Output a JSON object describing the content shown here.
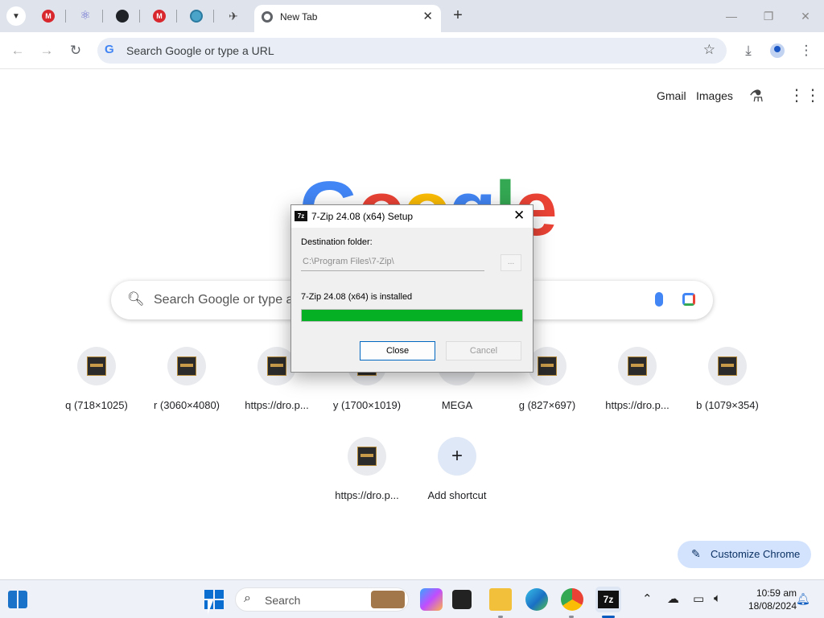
{
  "browser": {
    "active_tab_title": "New Tab",
    "omnibox_placeholder": "Search Google or type a URL"
  },
  "ntp": {
    "gmail": "Gmail",
    "images": "Images",
    "logo_text": "Google",
    "search_placeholder": "Search Google or type a URL",
    "shortcuts": [
      {
        "label": "q (718×1025)"
      },
      {
        "label": "r (3060×4080)"
      },
      {
        "label": "https://dro.p..."
      },
      {
        "label": "y (1700×1019)"
      },
      {
        "label": "MEGA"
      },
      {
        "label": "g (827×697)"
      },
      {
        "label": "https://dro.p..."
      },
      {
        "label": "b (1079×354)"
      },
      {
        "label": "https://dro.p..."
      },
      {
        "label": "Add shortcut"
      }
    ],
    "customize_label": "Customize Chrome"
  },
  "dialog": {
    "title": "7-Zip 24.08 (x64) Setup",
    "app_icon_text": "7z",
    "destination_label": "Destination folder:",
    "destination_value": "C:\\Program Files\\7-Zip\\",
    "browse_label": "...",
    "status_text": "7-Zip 24.08 (x64) is installed",
    "progress_percent": 100,
    "close_label": "Close",
    "cancel_label": "Cancel"
  },
  "taskbar": {
    "search_label": "Search",
    "time": "10:59 am",
    "date": "18/08/2024",
    "active_app_label": "7z"
  },
  "colors": {
    "progress_fill": "#06b025",
    "accent": "#0067c0",
    "google_blue": "#4285f4",
    "google_red": "#ea4335",
    "google_yellow": "#fbbc05",
    "google_green": "#34a853"
  }
}
